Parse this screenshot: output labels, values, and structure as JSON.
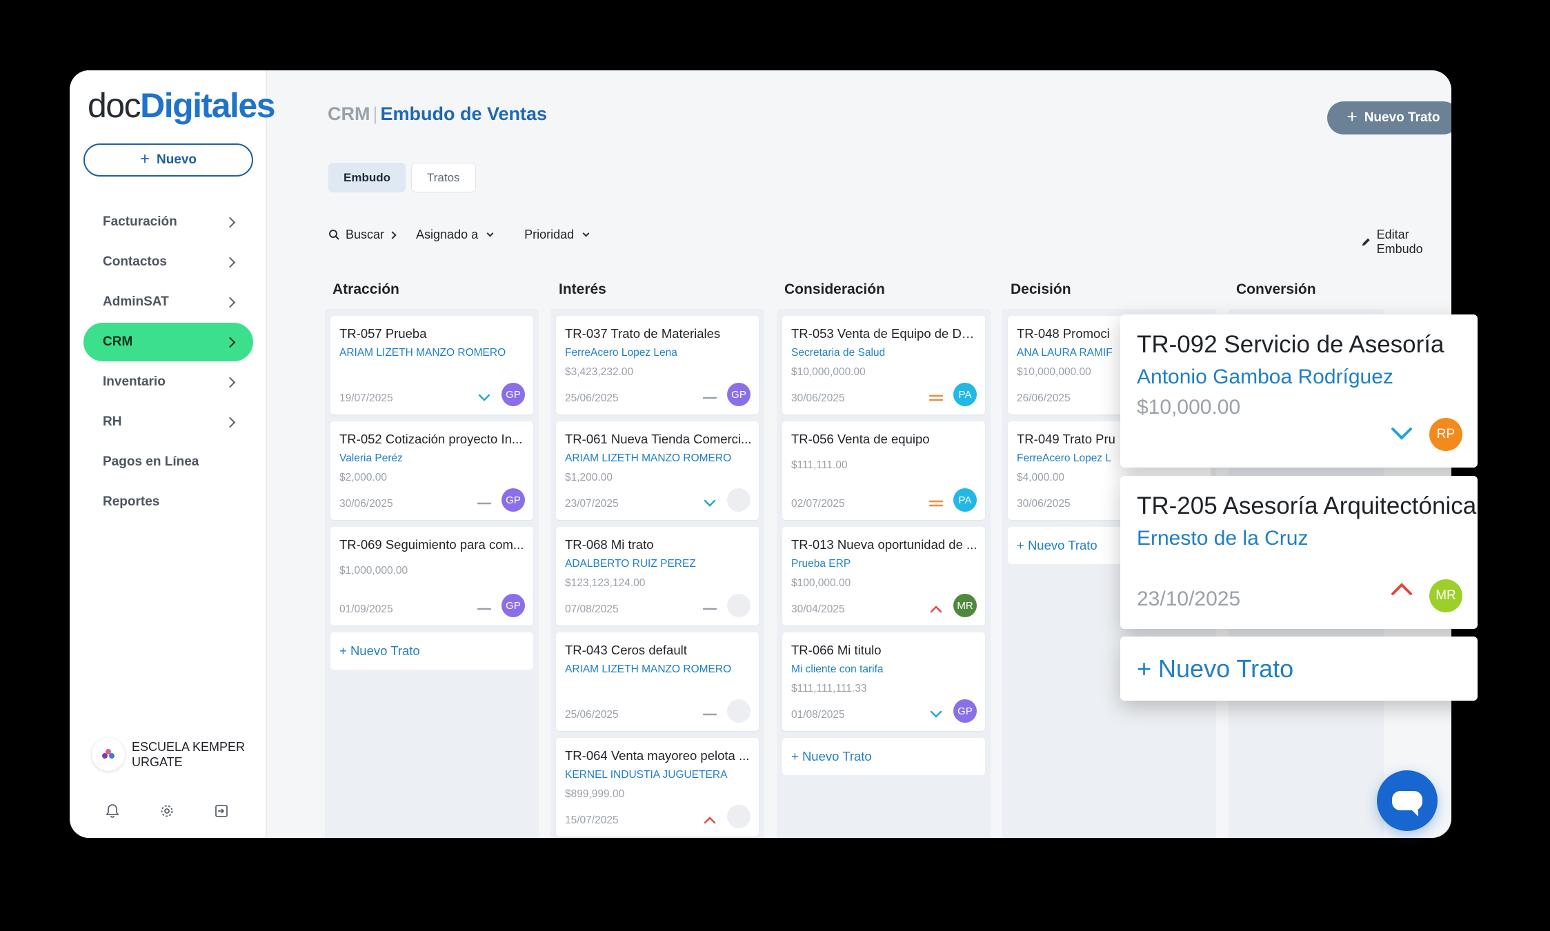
{
  "sidebar": {
    "logo_doc": "doc",
    "logo_digitales": "Digitales",
    "new_button": "Nuevo",
    "items": [
      {
        "label": "Facturación"
      },
      {
        "label": "Contactos"
      },
      {
        "label": "AdminSAT"
      },
      {
        "label": "CRM"
      },
      {
        "label": "Inventario"
      },
      {
        "label": "RH"
      },
      {
        "label": "Pagos en Línea"
      },
      {
        "label": "Reportes"
      }
    ],
    "org_name": "ESCUELA KEMPER URGATE"
  },
  "header": {
    "section": "CRM",
    "separator": "|",
    "title": "Embudo de Ventas",
    "new_deal_button": "Nuevo Trato"
  },
  "tabs": [
    {
      "label": "Embudo"
    },
    {
      "label": "Tratos"
    }
  ],
  "filters": {
    "search": "Buscar",
    "assigned": "Asignado a",
    "priority": "Prioridad",
    "edit": "Editar Embudo"
  },
  "colors": {
    "accent_green": "#3ce08c",
    "brand_blue": "#1f74c9",
    "link_blue": "#1f7fc4"
  },
  "columns": [
    {
      "title": "Atracción"
    },
    {
      "title": "Interés"
    },
    {
      "title": "Consideración"
    },
    {
      "title": "Decisión"
    },
    {
      "title": "Conversión"
    }
  ],
  "add_deal": "+ Nuevo Trato",
  "cards": {
    "c1": [
      {
        "title": "TR-057 Prueba",
        "client": "ARIAM LIZETH MANZO ROMERO",
        "amount": "",
        "date": "19/07/2025",
        "priority": "down",
        "avatar": "GP",
        "avatar_color": "#8b6fe8"
      },
      {
        "title": "TR-052 Cotización proyecto In...",
        "client": "Valeria Peréz",
        "amount": "$2,000.00",
        "date": "30/06/2025",
        "priority": "none",
        "avatar": "GP",
        "avatar_color": "#8b6fe8"
      },
      {
        "title": "TR-069 Seguimiento para com...",
        "client": "",
        "amount": "$1,000,000.00",
        "date": "01/09/2025",
        "priority": "none",
        "avatar": "GP",
        "avatar_color": "#8b6fe8"
      }
    ],
    "c2": [
      {
        "title": "TR-037 Trato de Materiales",
        "client": "FerreAcero Lopez Lena",
        "amount": "$3,423,232.00",
        "date": "25/06/2025",
        "priority": "none",
        "avatar": "GP",
        "avatar_color": "#8b6fe8"
      },
      {
        "title": "TR-061 Nueva Tienda Comerci...",
        "client": "ARIAM LIZETH MANZO ROMERO",
        "amount": "$1,200.00",
        "date": "23/07/2025",
        "priority": "down",
        "avatar": "",
        "avatar_color": "#eceef1"
      },
      {
        "title": "TR-068 Mi trato",
        "client": "ADALBERTO RUIZ PEREZ",
        "amount": "$123,123,124.00",
        "date": "07/08/2025",
        "priority": "none",
        "avatar": "",
        "avatar_color": "#eceef1"
      },
      {
        "title": "TR-043 Ceros default",
        "client": "ARIAM LIZETH MANZO ROMERO",
        "amount": "",
        "date": "25/06/2025",
        "priority": "none",
        "avatar": "",
        "avatar_color": "#eceef1"
      },
      {
        "title": "TR-064 Venta mayoreo pelota ...",
        "client": "KERNEL INDUSTIA JUGUETERA",
        "amount": "$899,999.00",
        "date": "15/07/2025",
        "priority": "up",
        "avatar": "",
        "avatar_color": "#eceef1"
      }
    ],
    "c3": [
      {
        "title": "TR-053 Venta de Equipo de De...",
        "client": "Secretaria de Salud",
        "amount": "$10,000,000.00",
        "date": "30/06/2025",
        "priority": "medium",
        "avatar": "PA",
        "avatar_color": "#22b8e6"
      },
      {
        "title": "TR-056 Venta de equipo",
        "client": "",
        "amount": "$111,111.00",
        "date": "02/07/2025",
        "priority": "medium",
        "avatar": "PA",
        "avatar_color": "#22b8e6"
      },
      {
        "title": "TR-013 Nueva oportunidad de ...",
        "client": "Prueba ERP",
        "amount": "$100,000.00",
        "date": "30/04/2025",
        "priority": "up",
        "avatar": "MR",
        "avatar_color": "#4f8a3c"
      },
      {
        "title": "TR-066 Mi titulo",
        "client": "Mi cliente con tarifa",
        "amount": "$111,111,111.33",
        "date": "01/08/2025",
        "priority": "down",
        "avatar": "GP",
        "avatar_color": "#8b6fe8"
      }
    ],
    "c4": [
      {
        "title": "TR-048 Promoci",
        "client": "ANA LAURA RAMIF",
        "amount": "$10,000,000.00",
        "date": "26/06/2025"
      },
      {
        "title": "TR-049 Trato Pru",
        "client": "FerreAcero Lopez L",
        "amount": "$4,000.00",
        "date": "30/06/2025"
      }
    ]
  },
  "zoom": [
    {
      "title": "TR-092 Servicio de Asesoría",
      "client": "Antonio Gamboa Rodríguez",
      "amount": "$10,000.00",
      "priority": "down",
      "avatar": "RP",
      "avatar_color": "#f28a1c"
    },
    {
      "title": "TR-205 Asesoría Arquitectónica",
      "client": "Ernesto de la Cruz",
      "date": "23/10/2025",
      "priority": "up",
      "avatar": "MR",
      "avatar_color": "#9ccf2a"
    }
  ]
}
